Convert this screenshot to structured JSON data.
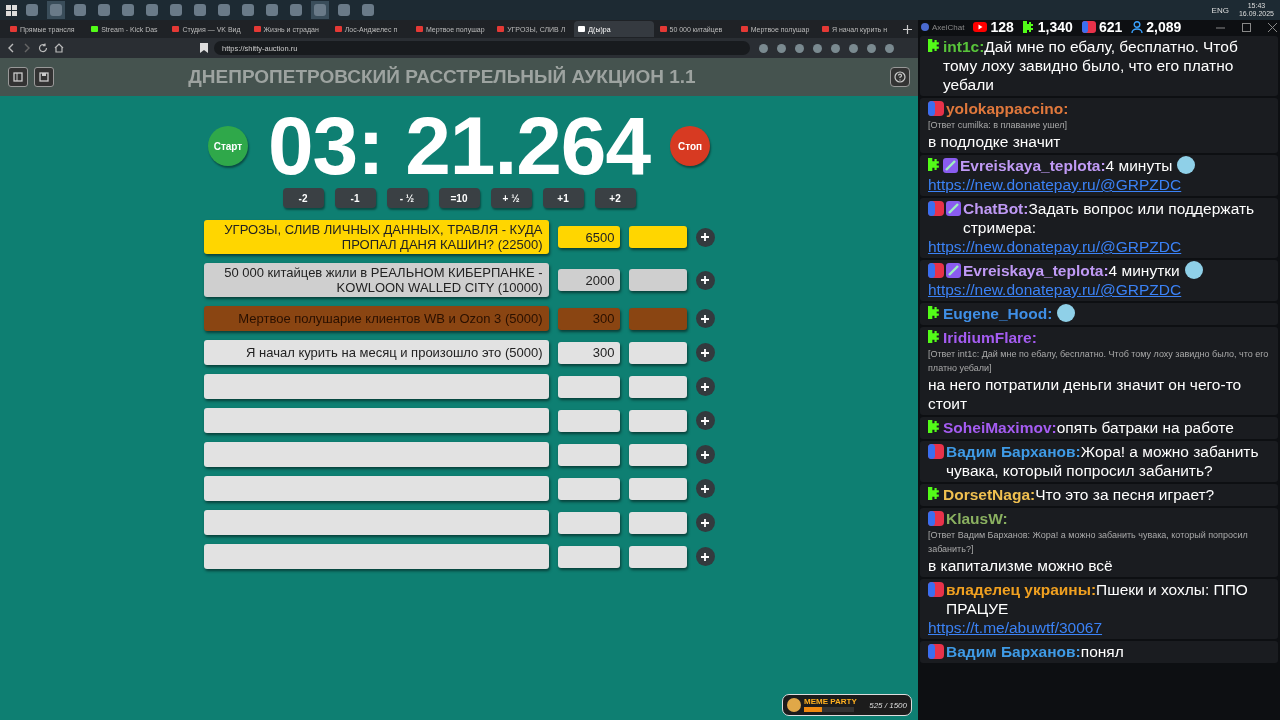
{
  "taskbar": {
    "apps": [
      {
        "selected": false
      },
      {
        "selected": true
      },
      {
        "selected": false
      },
      {
        "selected": false
      },
      {
        "selected": false
      },
      {
        "selected": false
      },
      {
        "selected": false
      },
      {
        "selected": false
      },
      {
        "selected": false
      },
      {
        "selected": false
      },
      {
        "selected": false
      },
      {
        "selected": false
      },
      {
        "selected": true
      },
      {
        "selected": false
      },
      {
        "selected": false
      }
    ],
    "language": "ENG",
    "time": "15:43",
    "date": "16.09.2025"
  },
  "browser": {
    "tabs": [
      {
        "title": "Прямые трансля",
        "selected": false,
        "color": "#e53935"
      },
      {
        "title": "Stream - Kick Das",
        "selected": false,
        "color": "#53fc18"
      },
      {
        "title": "Студия — VK Вид",
        "selected": false,
        "color": "#e53935"
      },
      {
        "title": "Жизнь и страдан",
        "selected": false,
        "color": "#e53935"
      },
      {
        "title": "Лос-Анджелес п",
        "selected": false,
        "color": "#e53935"
      },
      {
        "title": "Мертвое полушар",
        "selected": false,
        "color": "#e53935"
      },
      {
        "title": "УГРОЗЫ, СЛИВ Л",
        "selected": false,
        "color": "#e53935"
      },
      {
        "title": "Д(ы)ра",
        "selected": true,
        "color": "#ffffff"
      },
      {
        "title": "50 000 китайцев",
        "selected": false,
        "color": "#e53935"
      },
      {
        "title": "Мертвое полушар",
        "selected": false,
        "color": "#e53935"
      },
      {
        "title": "Я начал курить н",
        "selected": false,
        "color": "#e53935"
      }
    ],
    "url": "https://shitty-auction.ru"
  },
  "page": {
    "title": "ДНЕПРОПЕТРОВСКИЙ РАССТРЕЛЬНЫЙ АУКЦИОН 1.1",
    "start": "Старт",
    "timer": "03: 21.264",
    "stop": "Стоп",
    "time_buttons": [
      "-2",
      "-1",
      "- ½",
      "=10",
      "+ ½",
      "+1",
      "+2"
    ],
    "lots": [
      {
        "name": "УГРОЗЫ, СЛИВ ЛИЧНЫХ ДАННЫХ, ТРАВЛЯ - КУДА ПРОПАЛ ДАНЯ КАШИН? (22500)",
        "amount": "6500",
        "color": "#ffd600"
      },
      {
        "name": "50 000 китайцев жили в РЕАЛЬНОМ КИБЕРПАНКЕ - KOWLOON WALLED CITY (10000)",
        "amount": "2000",
        "color": "#cfcfcf"
      },
      {
        "name": "Мертвое полушарие клиентов WB и Ozon 3 (5000)",
        "amount": "300",
        "color": "#8a4512"
      },
      {
        "name": "Я начал курить на месяц и произошло это (5000)",
        "amount": "300",
        "color": "#e2e2e2"
      },
      {
        "color": "#e2e2e2"
      },
      {
        "color": "#e2e2e2"
      },
      {
        "color": "#e2e2e2"
      },
      {
        "color": "#e2e2e2"
      },
      {
        "color": "#e2e2e2"
      },
      {
        "color": "#e2e2e2"
      }
    ],
    "meme_widget": {
      "title": "MEME PARTY",
      "count": "525 / 1500",
      "level": 0.35
    }
  },
  "chat": {
    "app": "AxelChat",
    "counts": [
      {
        "kind": "youtube",
        "value": "128"
      },
      {
        "kind": "kick",
        "value": "1,340"
      },
      {
        "kind": "live",
        "value": "621"
      },
      {
        "kind": "viewers",
        "value": "2,089"
      }
    ],
    "messages": [
      {
        "kind": "kick",
        "user": "int1c:",
        "color": "#58c43a",
        "text": "Дай мне по ебалу, бесплатно. Чтоб тому лоху завидно было, что его платно уебали"
      },
      {
        "kind": "live",
        "user": "yolokappaccino:",
        "color": "#e0783c",
        "reply": "[Ответ cumilka: в плавание ушел]",
        "text": "в подлодке значит"
      },
      {
        "kind": "kick",
        "badge": true,
        "user": "Evreiskaya_teplota:",
        "color": "#c09af5",
        "text": "4 минуты",
        "emote": true,
        "link": "https://new.donatepay.ru/@GRPZDC"
      },
      {
        "kind": "live",
        "badge": true,
        "user": "ChatBot:",
        "color": "#c09af5",
        "text": "Задать вопрос или поддержать стримера:",
        "link": "https://new.donatepay.ru/@GRPZDC"
      },
      {
        "kind": "live",
        "badge": true,
        "user": "Evreiskaya_teplota:",
        "color": "#c09af5",
        "text": "4 минутки",
        "emote": true,
        "link": "https://new.donatepay.ru/@GRPZDC"
      },
      {
        "kind": "kick",
        "user": "Eugene_Hood:",
        "color": "#3f8fe6",
        "emote": true
      },
      {
        "kind": "kick",
        "user": "IridiumFlare:",
        "color": "#a55cf2",
        "reply": "[Ответ int1c: Дай мне по ебалу, бесплатно. Чтоб тому лоху завидно было, что его платно уебали]",
        "text": "на него потратили деньги значит он чего-то стоит"
      },
      {
        "kind": "kick",
        "user": "SoheiMaximov:",
        "color": "#a55cf2",
        "text": "опять батраки на работе"
      },
      {
        "kind": "live",
        "user": "Вадим Барханов:",
        "color": "#3f9be6",
        "text": "Жора! а можно забанить чувака, который попросил забанить?"
      },
      {
        "kind": "kick",
        "user": "DorsetNaga:",
        "color": "#f0c050",
        "text": "Что это за песня играет?"
      },
      {
        "kind": "live",
        "user": "KlausW:",
        "color": "#8ab060",
        "reply": "[Ответ Вадим Барханов: Жора! а можно забанить чувака, который попросил забанить?]",
        "text": "в капитализме можно всё"
      },
      {
        "kind": "live",
        "user": "владелец украины:",
        "color": "#f0a020",
        "text": "Пшеки и хохлы: ППО ПРАЦУЕ",
        "link": "https://t.me/abuwtf/30067"
      },
      {
        "kind": "live",
        "user": "Вадим Барханов:",
        "color": "#3f9be6",
        "text": "понял"
      }
    ]
  }
}
